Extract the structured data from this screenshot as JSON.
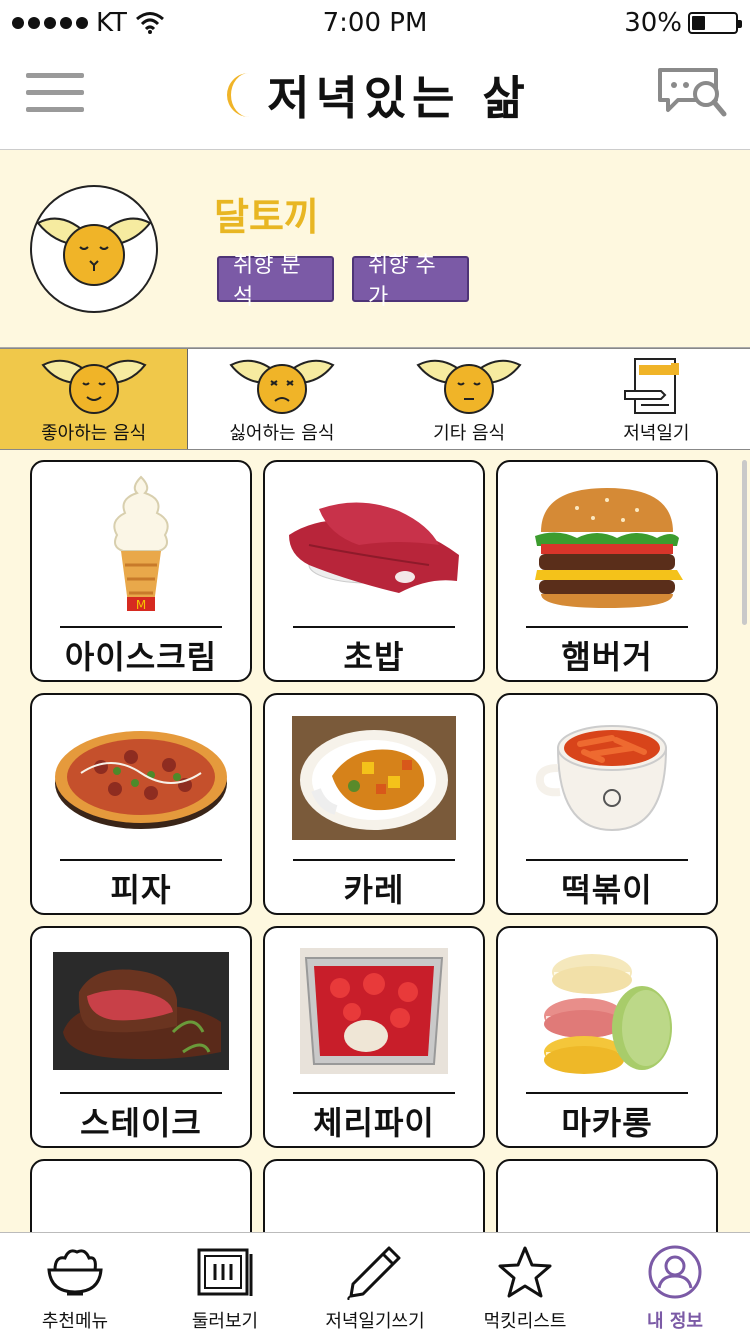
{
  "status_bar": {
    "carrier": "KT",
    "time": "7:00 PM",
    "battery_text": "30%",
    "battery_level": 0.3
  },
  "header": {
    "title": "저녁있는 삶",
    "menu_icon": "hamburger-menu-icon",
    "action_icon": "chat-search-icon"
  },
  "profile": {
    "nickname": "달토끼",
    "analyze_button": "취향 분석",
    "add_button": "취향 추가"
  },
  "tabs": [
    {
      "label": "좋아하는 음식",
      "icon": "happy-rabbit-icon",
      "active": true
    },
    {
      "label": "싫어하는 음식",
      "icon": "sad-rabbit-icon",
      "active": false
    },
    {
      "label": "기타 음식",
      "icon": "neutral-rabbit-icon",
      "active": false
    },
    {
      "label": "저녁일기",
      "icon": "diary-book-icon",
      "active": false
    }
  ],
  "foods": [
    {
      "label": "아이스크림",
      "image": "ice-cream-cone"
    },
    {
      "label": "초밥",
      "image": "tuna-sushi"
    },
    {
      "label": "햄버거",
      "image": "hamburger"
    },
    {
      "label": "피자",
      "image": "pizza"
    },
    {
      "label": "카레",
      "image": "curry-rice"
    },
    {
      "label": "떡볶이",
      "image": "tteokbokki"
    },
    {
      "label": "스테이크",
      "image": "steak"
    },
    {
      "label": "체리파이",
      "image": "cherry-pie"
    },
    {
      "label": "마카롱",
      "image": "macarons"
    }
  ],
  "bottom_nav": [
    {
      "label": "추천메뉴",
      "icon": "rice-bowl-icon",
      "active": false
    },
    {
      "label": "둘러보기",
      "icon": "browse-frame-icon",
      "active": false
    },
    {
      "label": "저녁일기쓰기",
      "icon": "pen-icon",
      "active": false
    },
    {
      "label": "먹킷리스트",
      "icon": "star-icon",
      "active": false
    },
    {
      "label": "내 정보",
      "icon": "user-profile-icon",
      "active": true
    }
  ],
  "colors": {
    "accent_purple": "#7b5aa6",
    "tab_active": "#f0c84a",
    "cream_bg": "#fef8df",
    "nickname_yellow": "#e8b623"
  }
}
